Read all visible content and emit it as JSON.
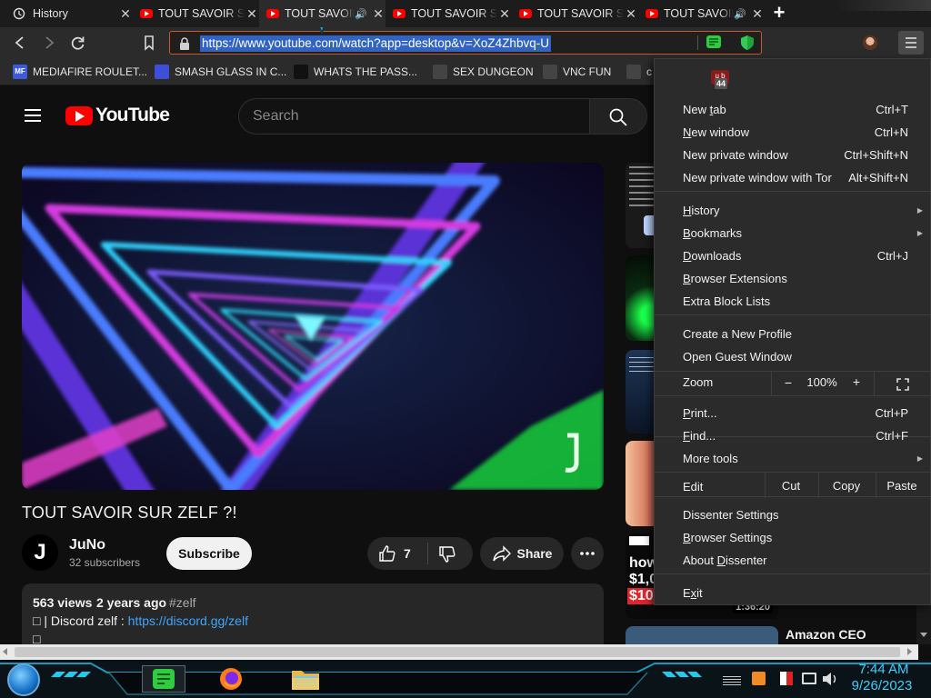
{
  "tabs": [
    {
      "title": "History",
      "kind": "history"
    },
    {
      "title": "TOUT SAVOIR SUR ZELF ?!",
      "kind": "youtube"
    },
    {
      "title": "TOUT SAVOIR SUR ZELF ?!",
      "kind": "youtube",
      "audio": true,
      "active": true
    },
    {
      "title": "TOUT SAVOIR SUR ZELF ?!",
      "kind": "youtube"
    },
    {
      "title": "TOUT SAVOIR SUR ZELF ?!",
      "kind": "youtube"
    },
    {
      "title": "TOUT SAVOIR SUR ZELF ?!",
      "kind": "youtube",
      "audio": true
    }
  ],
  "new_tab_label": "+",
  "toolbar": {
    "url": "https://www.youtube.com/watch?app=desktop&v=XoZ4Zhbvq-U"
  },
  "bookmarks": [
    {
      "label": "MEDIAFIRE ROULET...",
      "icon_color": "#3b5bdb",
      "icon_text": "MF"
    },
    {
      "label": "SMASH GLASS IN C...",
      "icon_color": "#3c4fd6"
    },
    {
      "label": "WHATS THE PASS...",
      "icon_color": "#111111"
    },
    {
      "label": "SEX DUNGEON",
      "icon_color": "#444444"
    },
    {
      "label": "VNC FUN",
      "icon_color": "#444444"
    },
    {
      "label": "c",
      "icon_color": "#444444"
    }
  ],
  "youtube": {
    "logo_text": "YouTube",
    "search_placeholder": "Search",
    "video_title": "TOUT SAVOIR SUR ZELF ?!",
    "channel_name": "JuNo",
    "channel_avatar_letter": "J",
    "subscribers": "32 subscribers",
    "subscribe_label": "Subscribe",
    "likes": "7",
    "share_label": "Share",
    "views": "563 views",
    "age": "2 years ago",
    "hashtag": "#zelf",
    "desc_line1_prefix": "□ | Discord zelf : ",
    "desc_link": "https://discord.gg/zelf",
    "desc_line2": "□",
    "sidebar": {
      "thumb5_label": "how",
      "thumb5_price": "$1,0",
      "thumb5_price2": "$10",
      "duration": "1:36:20",
      "amazon_title": "Amazon CEO"
    }
  },
  "menu": {
    "badge_text": "u b",
    "badge_count": "44",
    "items": [
      {
        "label": "New tab",
        "u": 4,
        "shortcut": "Ctrl+T"
      },
      {
        "label": "New window",
        "u": 0,
        "shortcut": "Ctrl+N"
      },
      {
        "label": "New private window",
        "shortcut": "Ctrl+Shift+N"
      },
      {
        "label": "New private window with Tor",
        "shortcut": "Alt+Shift+N"
      },
      {
        "label": "History",
        "u": 0,
        "submenu": true
      },
      {
        "label": "Bookmarks",
        "u": 0,
        "submenu": true
      },
      {
        "label": "Downloads",
        "u": 0,
        "shortcut": "Ctrl+J"
      },
      {
        "label": "Browser Extensions",
        "u": 0
      },
      {
        "label": "Extra Block Lists"
      },
      {
        "label": "Create a New Profile"
      },
      {
        "label": "Open Guest Window"
      },
      {
        "label": "Print...",
        "u": 0,
        "shortcut": "Ctrl+P"
      },
      {
        "label": "Find...",
        "u": 0,
        "shortcut": "Ctrl+F"
      },
      {
        "label": "More tools",
        "submenu": true
      },
      {
        "label": "Dissenter Settings"
      },
      {
        "label": "Browser Settings",
        "u": 0
      },
      {
        "label": "About Dissenter",
        "u": 6
      },
      {
        "label": "Exit",
        "u": 1
      }
    ],
    "zoom": {
      "label": "Zoom",
      "minus": "−",
      "value": "100%",
      "plus": "+"
    },
    "edit": {
      "label": "Edit",
      "cut": "Cut",
      "copy": "Copy",
      "paste": "Paste"
    }
  },
  "taskbar": {
    "time": "7:44 AM",
    "date": "9/26/2023"
  },
  "colors": {
    "youtube_red": "#ff0000",
    "url_selection": "#3164c2",
    "url_border": "#c45a2a",
    "menu_bg": "#2b2b2b",
    "subscribe_bg": "#f1f1f1"
  }
}
